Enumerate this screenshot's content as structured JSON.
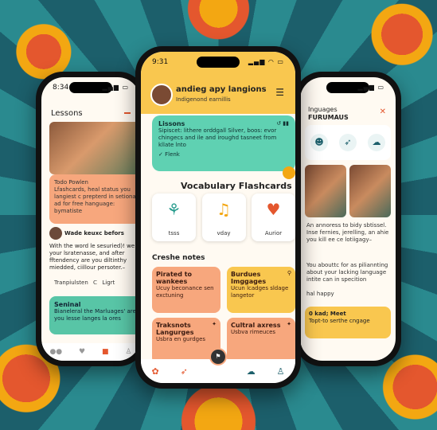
{
  "left": {
    "time": "8:34",
    "title": "Lessons",
    "card1": {
      "line1": "Todo Powlen",
      "line2": "Lfashcards, heal status you langiest c prepterd in setiona ad for free hanguage:",
      "line3": "bymatiste"
    },
    "post": {
      "author": "Wade keuxc befors",
      "body": "With the word le sesuried)! we your lsratenasse, and after fftendency are you diltinthy miedded, ciillour persoter.–"
    },
    "row": {
      "left": "Tranpiulsten",
      "right": "Ligrt"
    },
    "card2": {
      "title": "Seninal",
      "body": "Bianeleral the Marluages' are you lesse langes la ores"
    }
  },
  "center": {
    "time": "9:31",
    "title": "andieg apy langions",
    "subtitle": "Indigenond earnillis",
    "lessons": {
      "title": "Lissons",
      "body": "Sipiscet: lithere orddgall Silver, boos: evor chingecs and ile and iroughd tasneet from kllate lnto",
      "link": "Flenk"
    },
    "vocab_title": "Vocabulary Flashcards",
    "tiles": [
      {
        "label": "tsss"
      },
      {
        "label": "vday"
      },
      {
        "label": "Aurior"
      }
    ],
    "notes_title": "Creshe notes",
    "notes": [
      {
        "title": "Pirated to wankees",
        "body": "Ucuy beconance sen exctuning"
      },
      {
        "title": "Burdues Imggages",
        "body": "Ucun lcadges sldage langetor"
      },
      {
        "title": "Traksnots Langurges",
        "body": "Usbra en gurdges"
      },
      {
        "title": "Cultral axress",
        "body": "Usbva rimeuces"
      }
    ]
  },
  "right": {
    "title_line1": "Inguages",
    "title_line2": "FURUMAUS",
    "text1": "An annoress to bidy sbtissel. Inse fernies, jerelling, an ahie you kill ee ce lotiigagy–",
    "text2": "You abouttc for as piliannting about your lacking language intite can in specition",
    "happy": "hal happy",
    "card": {
      "title": "0 kad; Meet",
      "body": "Topt-to serthe cngage"
    }
  }
}
